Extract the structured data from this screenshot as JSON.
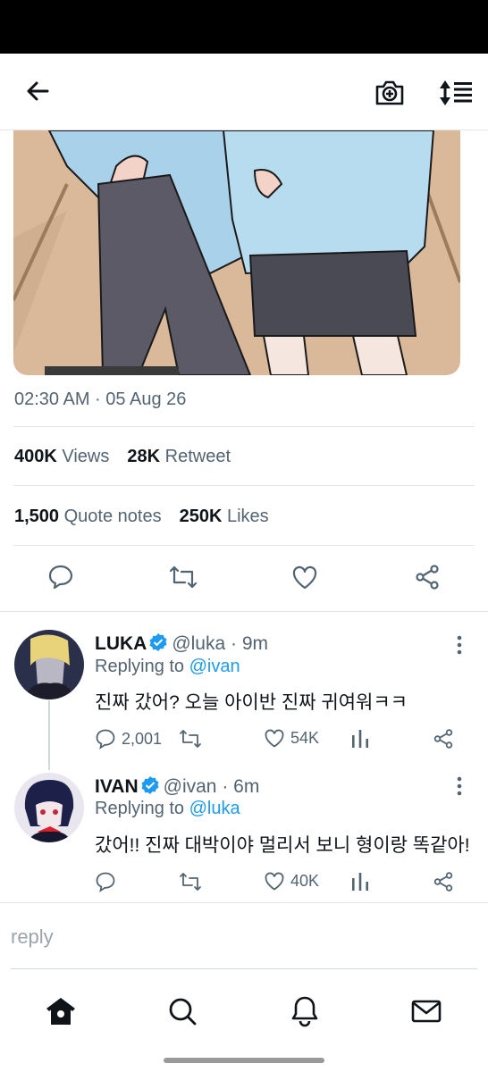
{
  "header": {
    "back_icon": "arrow-left-icon",
    "camera_icon": "camera-plus-icon",
    "sort_icon": "sort-list-icon"
  },
  "post": {
    "image_description": "illustrated-two-characters-light-blue-shirts",
    "timestamp": "02:30 AM · 05 Aug 26",
    "stats": {
      "views_count": "400K",
      "views_label": "Views",
      "retweet_count": "28K",
      "retweet_label": "Retweet",
      "quote_count": "1,500",
      "quote_label": "Quote notes",
      "likes_count": "250K",
      "likes_label": "Likes"
    },
    "actions": [
      "comment-icon",
      "retweet-icon",
      "heart-icon",
      "share-icon"
    ]
  },
  "replies": [
    {
      "name": "LUKA",
      "handle": "@luka",
      "time": "· 9m",
      "replying_prefix": "Replying to",
      "replying_to": "@ivan",
      "text": "진짜 갔어? 오늘 아이반 진짜 귀여워ㅋㅋ",
      "comments": "2,001",
      "retweets": "",
      "likes": "54K"
    },
    {
      "name": "IVAN",
      "handle": "@ivan",
      "time": "· 6m",
      "replying_prefix": "Replying to",
      "replying_to": "@luka",
      "text": "갔어!! 진짜 대박이야 멀리서 보니 형이랑 똑같아!",
      "comments": "",
      "retweets": "",
      "likes": "40K"
    }
  ],
  "composer": {
    "placeholder": "reply"
  },
  "nav": [
    "home-icon",
    "search-icon",
    "bell-icon",
    "mail-icon"
  ],
  "colors": {
    "accent": "#1d9bf0",
    "text": "#0f1419",
    "muted": "#536471"
  }
}
